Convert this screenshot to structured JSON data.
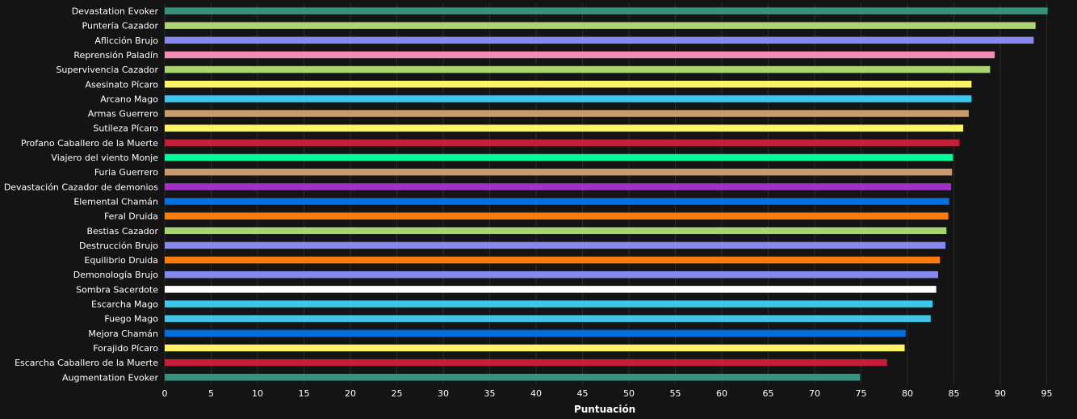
{
  "chart_data": {
    "type": "bar",
    "orientation": "horizontal",
    "categories": [
      "Devastation Evoker",
      "Puntería Cazador",
      "Aflicción Brujo",
      "Reprensión Paladín",
      "Supervivencia Cazador",
      "Asesinato Pícaro",
      "Arcano Mago",
      "Armas Guerrero",
      "Sutileza Pícaro",
      "Profano Caballero de la Muerte",
      "Viajero del viento Monje",
      "Furia Guerrero",
      "Devastación Cazador de demonios",
      "Elemental Chamán",
      "Feral Druida",
      "Bestias Cazador",
      "Destrucción Brujo",
      "Equilibrio Druida",
      "Demonología Brujo",
      "Sombra Sacerdote",
      "Escarcha Mago",
      "Fuego Mago",
      "Mejora Chamán",
      "Forajido Pícaro",
      "Escarcha Caballero de la Muerte",
      "Augmentation Evoker"
    ],
    "values": [
      95.1,
      93.8,
      93.6,
      89.4,
      88.9,
      86.9,
      86.9,
      86.6,
      86.0,
      85.6,
      84.9,
      84.8,
      84.7,
      84.5,
      84.4,
      84.2,
      84.1,
      83.5,
      83.3,
      83.1,
      82.7,
      82.5,
      79.8,
      79.7,
      77.8,
      74.9
    ],
    "colors": [
      "#33937f",
      "#aad372",
      "#8788ee",
      "#f48cba",
      "#aad372",
      "#fff468",
      "#3fc7eb",
      "#c69b6d",
      "#fff468",
      "#c41e3a",
      "#00ff98",
      "#c69b6d",
      "#a330c9",
      "#0070dd",
      "#ff7c0a",
      "#aad372",
      "#8788ee",
      "#ff7c0a",
      "#8788ee",
      "#ffffff",
      "#3fc7eb",
      "#3fc7eb",
      "#0070dd",
      "#fff468",
      "#c41e3a",
      "#33937f"
    ],
    "xlabel": "Puntuación",
    "ylabel": "",
    "xlim": [
      0,
      96
    ],
    "xticks": [
      0,
      5,
      10,
      15,
      20,
      25,
      30,
      35,
      40,
      45,
      50,
      55,
      60,
      65,
      70,
      75,
      80,
      85,
      90,
      95
    ],
    "grid": true,
    "legend": "none"
  }
}
